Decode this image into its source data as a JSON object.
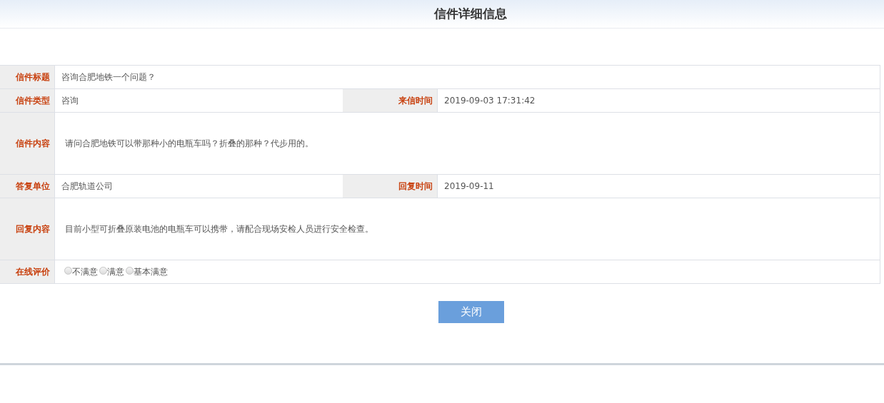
{
  "header": {
    "title": "信件详细信息"
  },
  "rows": [
    {
      "kind": "single",
      "label": "信件标题",
      "value": "咨询合肥地铁一个问题？"
    },
    {
      "kind": "double",
      "label": "信件类型",
      "value": "咨询",
      "label_2": "来信时间",
      "value_2": "2019-09-03 17:31:42"
    },
    {
      "kind": "tall",
      "label": "信件内容",
      "value": "请问合肥地铁可以带那种小的电瓶车吗？折叠的那种？代步用的。"
    },
    {
      "kind": "double",
      "label": "答复单位",
      "value": "合肥轨道公司",
      "label_2": "回复时间",
      "value_2": "2019-09-11"
    },
    {
      "kind": "tall",
      "label": "回复内容",
      "value": "目前小型可折叠原装电池的电瓶车可以携带，请配合现场安检人员进行安全检查。"
    },
    {
      "kind": "rating",
      "label": "在线评价",
      "options": [
        {
          "label": "不满意",
          "selected": false
        },
        {
          "label": "满意",
          "selected": false
        },
        {
          "label": "基本满意",
          "selected": false
        }
      ]
    }
  ],
  "close_button": "关闭"
}
